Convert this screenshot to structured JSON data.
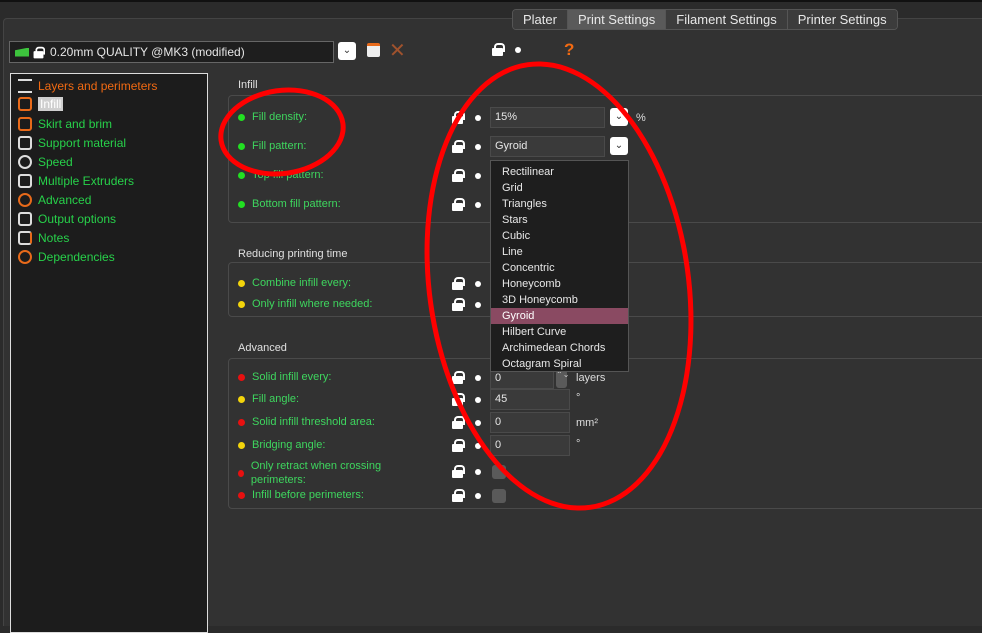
{
  "tabs": [
    "Plater",
    "Print Settings",
    "Filament Settings",
    "Printer Settings"
  ],
  "active_tab": "Print Settings",
  "preset": {
    "name": "0.20mm QUALITY @MK3 (modified)"
  },
  "help_label": "?",
  "sidebar": {
    "items": [
      {
        "label": "Layers and perimeters",
        "icon": "layers-icon"
      },
      {
        "label": "Infill",
        "icon": "infill-icon"
      },
      {
        "label": "Skirt and brim",
        "icon": "skirt-icon"
      },
      {
        "label": "Support material",
        "icon": "support-icon"
      },
      {
        "label": "Speed",
        "icon": "clock-icon"
      },
      {
        "label": "Multiple Extruders",
        "icon": "extruder-icon"
      },
      {
        "label": "Advanced",
        "icon": "gears-icon"
      },
      {
        "label": "Output options",
        "icon": "output-icon"
      },
      {
        "label": "Notes",
        "icon": "notes-icon"
      },
      {
        "label": "Dependencies",
        "icon": "gears-icon"
      }
    ]
  },
  "infill": {
    "title": "Infill",
    "rows": [
      {
        "label": "Fill density:",
        "value": "15%",
        "unit": "%"
      },
      {
        "label": "Fill pattern:",
        "value": "Gyroid"
      },
      {
        "label": "Top fill pattern:"
      },
      {
        "label": "Bottom fill pattern:"
      }
    ]
  },
  "reducing": {
    "title": "Reducing printing time",
    "rows": [
      {
        "label": "Combine infill every:"
      },
      {
        "label": "Only infill where needed:"
      }
    ]
  },
  "advanced": {
    "title": "Advanced",
    "rows": [
      {
        "label": "Solid infill every:",
        "value": "0",
        "unit": "layers"
      },
      {
        "label": "Fill angle:",
        "value": "45",
        "unit": "°"
      },
      {
        "label": "Solid infill threshold area:",
        "value": "0",
        "unit": "mm²"
      },
      {
        "label": "Bridging angle:",
        "value": "0",
        "unit": "°"
      },
      {
        "label": "Only retract when crossing perimeters:"
      },
      {
        "label": "Infill before perimeters:"
      }
    ]
  },
  "pattern_options": [
    "Rectilinear",
    "Grid",
    "Triangles",
    "Stars",
    "Cubic",
    "Line",
    "Concentric",
    "Honeycomb",
    "3D Honeycomb",
    "Gyroid",
    "Hilbert Curve",
    "Archimedean Chords",
    "Octagram Spiral"
  ],
  "colors": {
    "accent_green": "#3ed65e",
    "orange": "#f26a12",
    "highlight": "#8a4a62",
    "annotation_red": "#ff0000"
  }
}
